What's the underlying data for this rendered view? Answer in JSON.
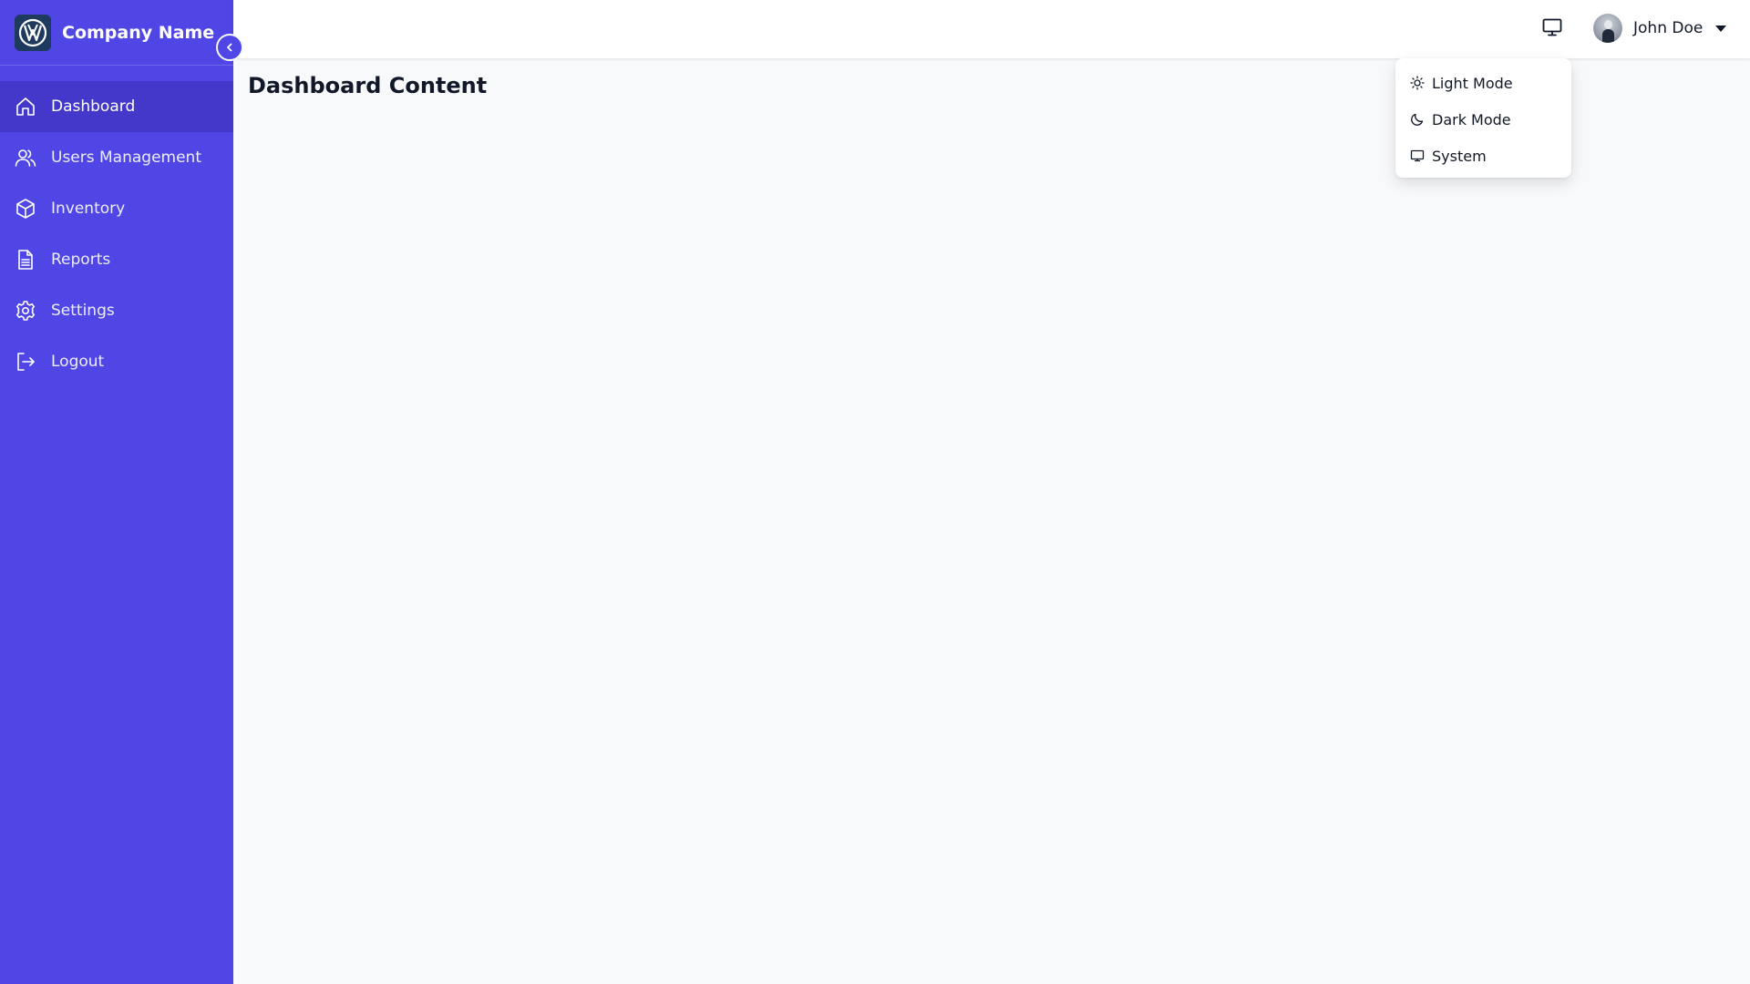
{
  "brand": {
    "name": "Company Name",
    "logo_icon": "vw-logo-icon"
  },
  "sidebar": {
    "items": [
      {
        "label": "Dashboard",
        "icon": "home-icon",
        "active": true
      },
      {
        "label": "Users Management",
        "icon": "users-icon",
        "active": false
      },
      {
        "label": "Inventory",
        "icon": "box-icon",
        "active": false
      },
      {
        "label": "Reports",
        "icon": "document-icon",
        "active": false
      },
      {
        "label": "Settings",
        "icon": "gear-icon",
        "active": false
      },
      {
        "label": "Logout",
        "icon": "logout-icon",
        "active": false
      }
    ]
  },
  "header": {
    "theme_icon": "monitor-icon",
    "user": {
      "name": "John Doe"
    }
  },
  "theme_menu": {
    "items": [
      {
        "label": "Light Mode",
        "icon": "sun-icon"
      },
      {
        "label": "Dark Mode",
        "icon": "moon-icon"
      },
      {
        "label": "System",
        "icon": "monitor-icon"
      }
    ]
  },
  "main": {
    "title": "Dashboard Content"
  },
  "colors": {
    "sidebar_bg": "#4f46e5",
    "sidebar_active": "#4338ca",
    "page_bg": "#f8f9fb",
    "header_bg": "#ffffff"
  }
}
